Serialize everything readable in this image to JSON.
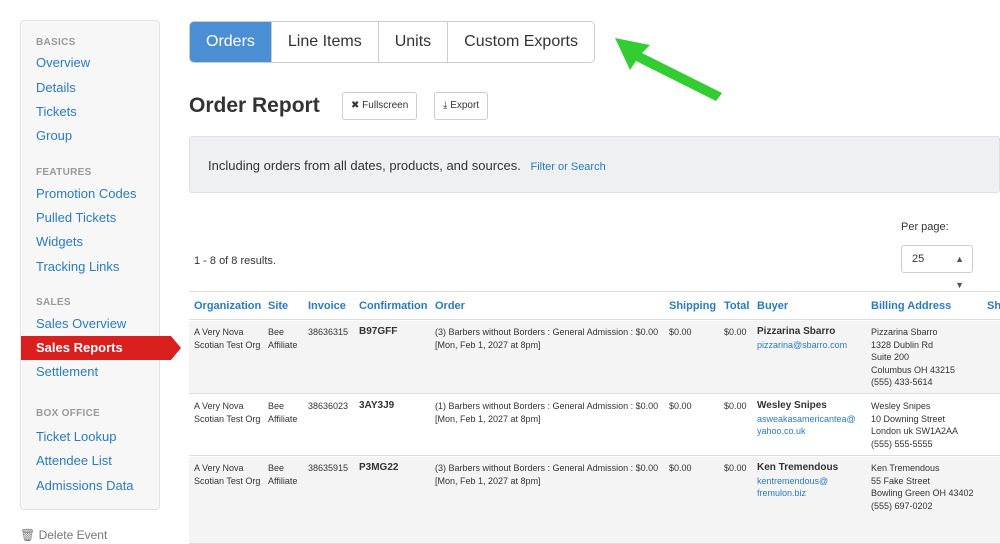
{
  "sidebar": {
    "sections": [
      {
        "title": "BASICS",
        "items": [
          "Overview",
          "Details",
          "Tickets",
          "Group"
        ]
      },
      {
        "title": "FEATURES",
        "items": [
          "Promotion Codes",
          "Pulled Tickets",
          "Widgets",
          "Tracking Links"
        ]
      },
      {
        "title": "SALES",
        "items": [
          "Sales Overview",
          "Sales Reports",
          "Settlement"
        ]
      },
      {
        "title": "BOX OFFICE",
        "items": [
          "Ticket Lookup",
          "Attendee List",
          "Admissions Data"
        ]
      }
    ],
    "active_item": "Sales Reports",
    "delete_event": "Delete Event"
  },
  "tabs": [
    "Orders",
    "Line Items",
    "Units",
    "Custom Exports"
  ],
  "active_tab": "Orders",
  "page_title": "Order Report",
  "buttons": {
    "fullscreen": "Fullscreen",
    "export": "Export"
  },
  "info": {
    "text": "Including orders from all dates, products, and sources.",
    "link": "Filter or Search"
  },
  "per_page": {
    "label": "Per page:",
    "value": "25"
  },
  "results": "1 - 8 of 8 results.",
  "table": {
    "headers": [
      "Organization",
      "Site",
      "Invoice",
      "Confirmation",
      "Order",
      "Shipping",
      "Total",
      "Buyer",
      "Billing Address",
      "Sh"
    ],
    "rows": [
      {
        "organization": "A Very Nova Scotian Test Org",
        "site": "Bee Affiliate",
        "invoice": "38636315",
        "confirmation": "B97GFF",
        "order": "(3) Barbers without Borders : General Admission : $0.00 [Mon, Feb 1, 2027 at 8pm]",
        "shipping": "$0.00",
        "total": "$0.00",
        "buyer_name": "Pizzarina Sbarro",
        "buyer_email": "pizzarina@sbarro.com",
        "billing": [
          "Pizzarina Sbarro",
          "1328 Dublin Rd",
          "Suite 200",
          "Columbus OH 43215",
          "(555) 433-5614"
        ]
      },
      {
        "organization": "A Very Nova Scotian Test Org",
        "site": "Bee Affiliate",
        "invoice": "38636023",
        "confirmation": "3AY3J9",
        "order": "(1) Barbers without Borders : General Admission : $0.00 [Mon, Feb 1, 2027 at 8pm]",
        "shipping": "$0.00",
        "total": "$0.00",
        "buyer_name": "Wesley Snipes",
        "buyer_email": "asweakasamericantea@ yahoo.co.uk",
        "billing": [
          "Wesley Snipes",
          "10 Downing Street",
          "London uk SW1A2AA",
          "(555) 555-5555"
        ]
      },
      {
        "organization": "A Very Nova Scotian Test Org",
        "site": "Bee Affiliate",
        "invoice": "38635915",
        "confirmation": "P3MG22",
        "order": "(3) Barbers without Borders : General Admission : $0.00 [Mon, Feb 1, 2027 at 8pm]",
        "shipping": "$0.00",
        "total": "$0.00",
        "buyer_name": "Ken Tremendous",
        "buyer_email": "kentremendous@ fremulon.biz",
        "billing": [
          "Ken Tremendous",
          "55 Fake Street",
          "Bowling Green OH 43402",
          "(555) 697-0202"
        ]
      }
    ]
  },
  "colors": {
    "accent": "#4a8fd4",
    "link": "#2a7ac2",
    "active": "#d9201f",
    "arrow": "#33cc33"
  }
}
